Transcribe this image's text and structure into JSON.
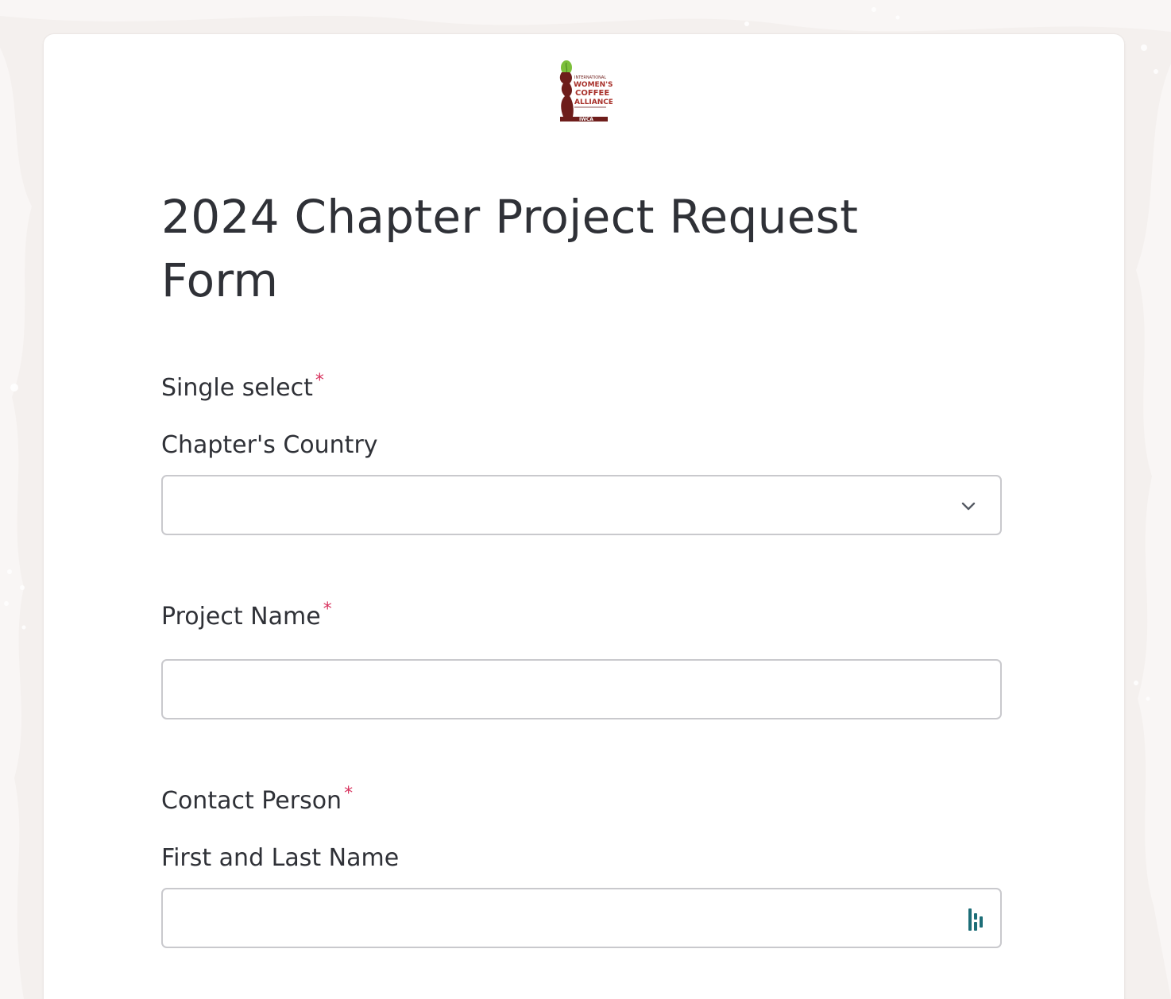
{
  "page": {
    "background_color": "#f4f0ee",
    "card_color": "#ffffff",
    "accent_required_color": "#d8345f"
  },
  "logo": {
    "icon": "iwca-logo",
    "lines": [
      "INTERNATIONAL",
      "WOMEN'S",
      "COFFEE",
      "ALLIANCE",
      "IWCA"
    ]
  },
  "form": {
    "title": "2024 Chapter Project Request Form",
    "fields": [
      {
        "label": "Single select",
        "required_mark": "*",
        "sublabel": "Chapter's Country",
        "type": "select",
        "value": "",
        "icon": "chevron-down-icon"
      },
      {
        "label": "Project Name",
        "required_mark": "*",
        "type": "text",
        "value": ""
      },
      {
        "label": "Contact Person",
        "required_mark": "*",
        "sublabel": "First and Last Name",
        "type": "text",
        "value": "",
        "icon": "autofill-extension-icon"
      }
    ]
  }
}
